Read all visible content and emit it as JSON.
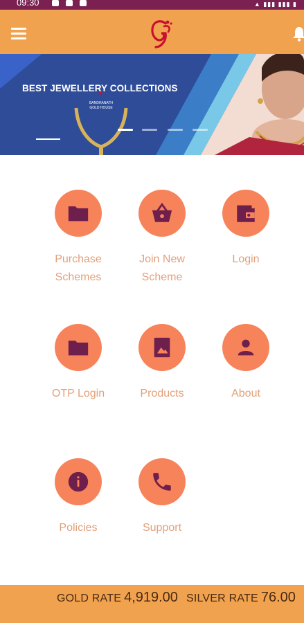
{
  "status_bar": {
    "time": "09:30"
  },
  "app_bar": {
    "menu_icon": "menu-icon",
    "logo_icon": "gj-logo",
    "bell_icon": "bell-icon",
    "color": "#f1a24f"
  },
  "banner": {
    "title": "BEST JEWELLERY COLLECTIONS",
    "brand_line1": "BANDHANATH",
    "brand_line2": "GOLD HOUSE"
  },
  "menu": [
    {
      "label": "Purchase\nSchemes",
      "icon": "folder-icon"
    },
    {
      "label": "Join New\nScheme",
      "icon": "basket-icon"
    },
    {
      "label": "Login",
      "icon": "wallet-icon"
    },
    {
      "label": "OTP Login",
      "icon": "folder-icon"
    },
    {
      "label": "Products",
      "icon": "image-icon"
    },
    {
      "label": "About",
      "icon": "person-icon"
    },
    {
      "label": "Policies",
      "icon": "info-icon"
    },
    {
      "label": "Support",
      "icon": "phone-icon"
    }
  ],
  "rates": {
    "gold_label": "GOLD RATE",
    "gold_value": "4,919.00",
    "silver_label": "SILVER RATE",
    "silver_value": "76.00"
  },
  "colors": {
    "accent": "#f1a24f",
    "circle": "#f7835b",
    "icon": "#6e1f4b",
    "label": "#e2a07a",
    "status_bar": "#7a2152"
  }
}
